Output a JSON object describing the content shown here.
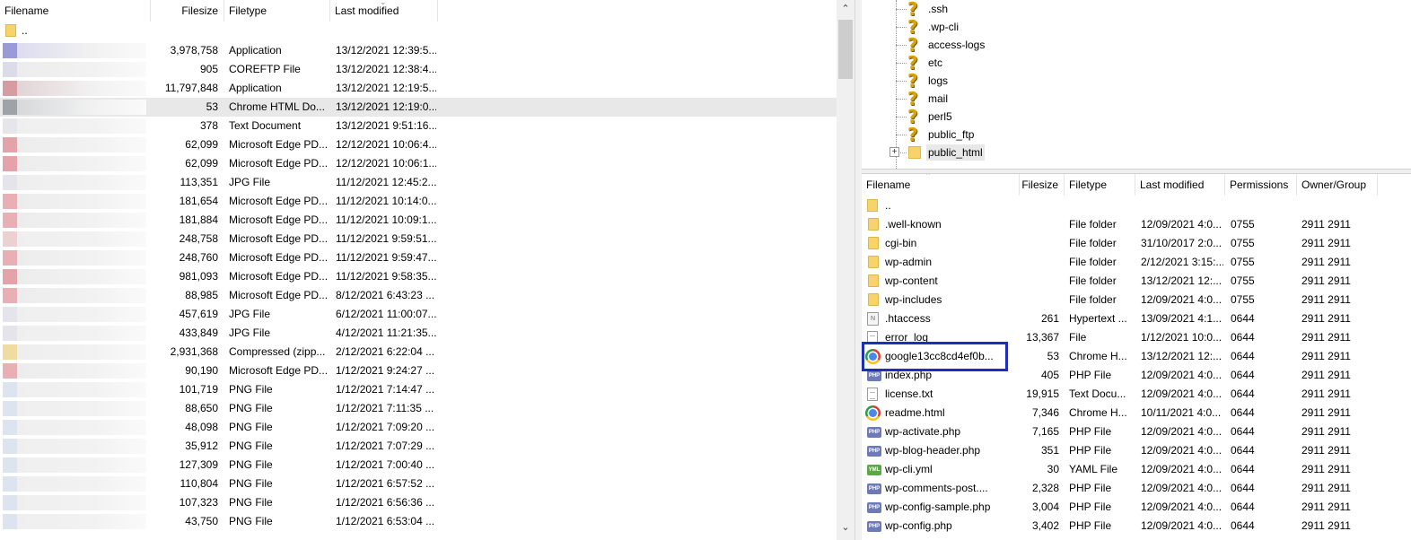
{
  "local": {
    "headers": {
      "filename": "Filename",
      "filesize": "Filesize",
      "filetype": "Filetype",
      "last_modified": "Last modified"
    },
    "parent": "..",
    "rows": [
      {
        "size": "3,978,758",
        "type": "Application",
        "modified": "13/12/2021 12:39:5...",
        "c1": "#9a9ad6",
        "c2": "#dcdcf0"
      },
      {
        "size": "905",
        "type": "COREFTP File",
        "modified": "13/12/2021 12:38:4...",
        "c1": "#dcdce8",
        "c2": "#ececec"
      },
      {
        "size": "11,797,848",
        "type": "Application",
        "modified": "13/12/2021 12:19:5...",
        "c1": "#d69ca2",
        "c2": "#e2d4d6"
      },
      {
        "size": "53",
        "type": "Chrome HTML Do...",
        "modified": "13/12/2021 12:19:0...",
        "c1": "#9ea3a8",
        "c2": "#d6d8da",
        "selected": true
      },
      {
        "size": "378",
        "type": "Text Document",
        "modified": "13/12/2021 9:51:16...",
        "c1": "#e6e6ea",
        "c2": "#efefef"
      },
      {
        "size": "62,099",
        "type": "Microsoft Edge PD...",
        "modified": "12/12/2021 10:06:4...",
        "c1": "#e3a3a8",
        "c2": "#ececec"
      },
      {
        "size": "62,099",
        "type": "Microsoft Edge PD...",
        "modified": "12/12/2021 10:06:1...",
        "c1": "#e3a3a8",
        "c2": "#ececec"
      },
      {
        "size": "113,351",
        "type": "JPG File",
        "modified": "11/12/2021 12:45:2...",
        "c1": "#e4e4ea",
        "c2": "#eeeeee"
      },
      {
        "size": "181,654",
        "type": "Microsoft Edge PD...",
        "modified": "11/12/2021 10:14:0...",
        "c1": "#e8b0b4",
        "c2": "#ececec"
      },
      {
        "size": "181,884",
        "type": "Microsoft Edge PD...",
        "modified": "11/12/2021 10:09:1...",
        "c1": "#e8b0b4",
        "c2": "#ececec"
      },
      {
        "size": "248,758",
        "type": "Microsoft Edge PD...",
        "modified": "11/12/2021 9:59:51...",
        "c1": "#ecd0d2",
        "c2": "#efefef"
      },
      {
        "size": "248,760",
        "type": "Microsoft Edge PD...",
        "modified": "11/12/2021 9:59:47...",
        "c1": "#e8b0b4",
        "c2": "#ececec"
      },
      {
        "size": "981,093",
        "type": "Microsoft Edge PD...",
        "modified": "11/12/2021 9:58:35...",
        "c1": "#e3a3a8",
        "c2": "#ececec"
      },
      {
        "size": "88,985",
        "type": "Microsoft Edge PD...",
        "modified": "8/12/2021 6:43:23 ...",
        "c1": "#e8b0b4",
        "c2": "#ececec"
      },
      {
        "size": "457,619",
        "type": "JPG File",
        "modified": "6/12/2021 11:00:07...",
        "c1": "#e4e4ea",
        "c2": "#efefef"
      },
      {
        "size": "433,849",
        "type": "JPG File",
        "modified": "4/12/2021 11:21:35...",
        "c1": "#e4e4ea",
        "c2": "#efefef"
      },
      {
        "size": "2,931,368",
        "type": "Compressed (zipp...",
        "modified": "2/12/2021 6:22:04 ...",
        "c1": "#f0dca0",
        "c2": "#eeeeee"
      },
      {
        "size": "90,190",
        "type": "Microsoft Edge PD...",
        "modified": "1/12/2021 9:24:27 ...",
        "c1": "#e8b0b4",
        "c2": "#ececec"
      },
      {
        "size": "101,719",
        "type": "PNG File",
        "modified": "1/12/2021 7:14:47 ...",
        "c1": "#dde3ef",
        "c2": "#efefef"
      },
      {
        "size": "88,650",
        "type": "PNG File",
        "modified": "1/12/2021 7:11:35 ...",
        "c1": "#dde3ef",
        "c2": "#efefef"
      },
      {
        "size": "48,098",
        "type": "PNG File",
        "modified": "1/12/2021 7:09:20 ...",
        "c1": "#dde3ef",
        "c2": "#efefef"
      },
      {
        "size": "35,912",
        "type": "PNG File",
        "modified": "1/12/2021 7:07:29 ...",
        "c1": "#dde3ef",
        "c2": "#efefef"
      },
      {
        "size": "127,309",
        "type": "PNG File",
        "modified": "1/12/2021 7:00:40 ...",
        "c1": "#dde3ef",
        "c2": "#efefef"
      },
      {
        "size": "110,804",
        "type": "PNG File",
        "modified": "1/12/2021 6:57:52 ...",
        "c1": "#dde3ef",
        "c2": "#efefef"
      },
      {
        "size": "107,323",
        "type": "PNG File",
        "modified": "1/12/2021 6:56:36 ...",
        "c1": "#dde3ef",
        "c2": "#efefef"
      },
      {
        "size": "43,750",
        "type": "PNG File",
        "modified": "1/12/2021 6:53:04 ...",
        "c1": "#dde3ef",
        "c2": "#efefef"
      }
    ]
  },
  "tree": {
    "items": [
      {
        "label": ".ssh",
        "icon": "question-icon"
      },
      {
        "label": ".wp-cli",
        "icon": "question-icon"
      },
      {
        "label": "access-logs",
        "icon": "question-icon"
      },
      {
        "label": "etc",
        "icon": "question-icon"
      },
      {
        "label": "logs",
        "icon": "question-icon"
      },
      {
        "label": "mail",
        "icon": "question-icon"
      },
      {
        "label": "perl5",
        "icon": "question-icon"
      },
      {
        "label": "public_ftp",
        "icon": "question-icon"
      },
      {
        "label": "public_html",
        "icon": "folder-icon",
        "selected": true
      }
    ],
    "expander": "+"
  },
  "remote": {
    "headers": {
      "filename": "Filename",
      "filesize": "Filesize",
      "filetype": "Filetype",
      "last_modified": "Last modified",
      "permissions": "Permissions",
      "owner": "Owner/Group"
    },
    "parent": "..",
    "rows": [
      {
        "name": ".well-known",
        "size": "",
        "type": "File folder",
        "modified": "12/09/2021 4:0...",
        "perms": "0755",
        "owner": "2911 2911",
        "icon": "folder"
      },
      {
        "name": "cgi-bin",
        "size": "",
        "type": "File folder",
        "modified": "31/10/2017 2:0...",
        "perms": "0755",
        "owner": "2911 2911",
        "icon": "folder"
      },
      {
        "name": "wp-admin",
        "size": "",
        "type": "File folder",
        "modified": "2/12/2021 3:15:...",
        "perms": "0755",
        "owner": "2911 2911",
        "icon": "folder"
      },
      {
        "name": "wp-content",
        "size": "",
        "type": "File folder",
        "modified": "13/12/2021 12:...",
        "perms": "0755",
        "owner": "2911 2911",
        "icon": "folder"
      },
      {
        "name": "wp-includes",
        "size": "",
        "type": "File folder",
        "modified": "12/09/2021 4:0...",
        "perms": "0755",
        "owner": "2911 2911",
        "icon": "folder"
      },
      {
        "name": ".htaccess",
        "size": "261",
        "type": "Hypertext ...",
        "modified": "13/09/2021 4:1...",
        "perms": "0644",
        "owner": "2911 2911",
        "icon": "htaccess"
      },
      {
        "name": "error_log",
        "size": "13,367",
        "type": "File",
        "modified": "1/12/2021 10:0...",
        "perms": "0644",
        "owner": "2911 2911",
        "icon": "doc"
      },
      {
        "name": "google13cc8cd4ef0b...",
        "size": "53",
        "type": "Chrome H...",
        "modified": "13/12/2021 12:...",
        "perms": "0644",
        "owner": "2911 2911",
        "icon": "chrome"
      },
      {
        "name": "index.php",
        "size": "405",
        "type": "PHP File",
        "modified": "12/09/2021 4:0...",
        "perms": "0644",
        "owner": "2911 2911",
        "icon": "php"
      },
      {
        "name": "license.txt",
        "size": "19,915",
        "type": "Text Docu...",
        "modified": "12/09/2021 4:0...",
        "perms": "0644",
        "owner": "2911 2911",
        "icon": "doc"
      },
      {
        "name": "readme.html",
        "size": "7,346",
        "type": "Chrome H...",
        "modified": "10/11/2021 4:0...",
        "perms": "0644",
        "owner": "2911 2911",
        "icon": "chrome"
      },
      {
        "name": "wp-activate.php",
        "size": "7,165",
        "type": "PHP File",
        "modified": "12/09/2021 4:0...",
        "perms": "0644",
        "owner": "2911 2911",
        "icon": "php"
      },
      {
        "name": "wp-blog-header.php",
        "size": "351",
        "type": "PHP File",
        "modified": "12/09/2021 4:0...",
        "perms": "0644",
        "owner": "2911 2911",
        "icon": "php"
      },
      {
        "name": "wp-cli.yml",
        "size": "30",
        "type": "YAML File",
        "modified": "12/09/2021 4:0...",
        "perms": "0644",
        "owner": "2911 2911",
        "icon": "yml"
      },
      {
        "name": "wp-comments-post....",
        "size": "2,328",
        "type": "PHP File",
        "modified": "12/09/2021 4:0...",
        "perms": "0644",
        "owner": "2911 2911",
        "icon": "php"
      },
      {
        "name": "wp-config-sample.php",
        "size": "3,004",
        "type": "PHP File",
        "modified": "12/09/2021 4:0...",
        "perms": "0644",
        "owner": "2911 2911",
        "icon": "php"
      },
      {
        "name": "wp-config.php",
        "size": "3,402",
        "type": "PHP File",
        "modified": "12/09/2021 4:0...",
        "perms": "0644",
        "owner": "2911 2911",
        "icon": "php"
      }
    ]
  },
  "colors": {
    "highlight": "#1f2fb5",
    "selected_row": "#e8e8e8"
  }
}
